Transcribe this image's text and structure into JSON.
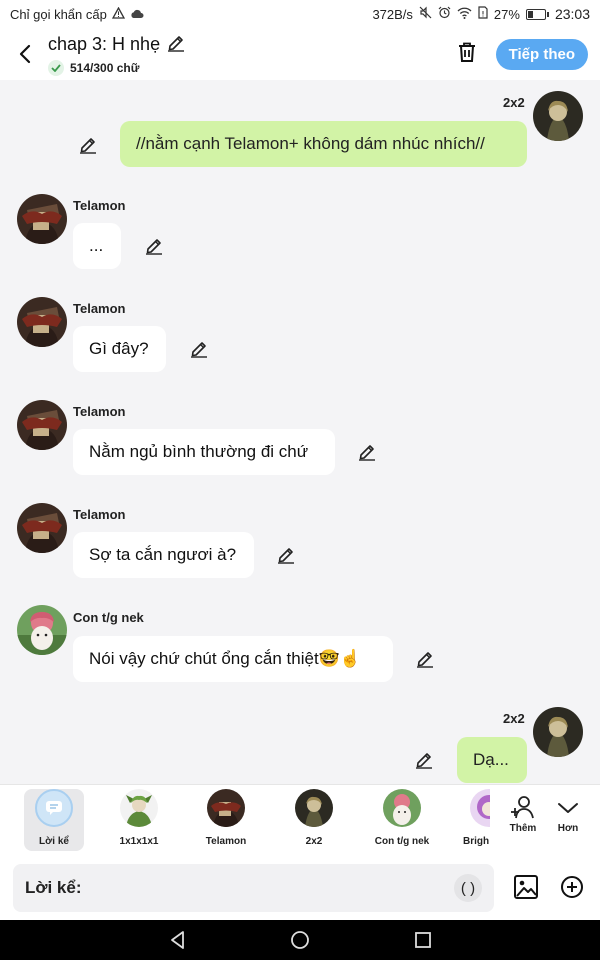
{
  "status_bar": {
    "carrier": "Chỉ gọi khẩn cấp",
    "speed": "372B/s",
    "battery": "27%",
    "time": "23:03"
  },
  "header": {
    "title": "chap 3: H nhẹ",
    "word_count": "514/300 chữ",
    "next_label": "Tiếp theo"
  },
  "messages": [
    {
      "side": "right",
      "name": "2x2",
      "text": "//nằm cạnh Telamon+ không dám nhúc nhích//",
      "avatar": "2x2"
    },
    {
      "side": "left",
      "name": "Telamon",
      "text": "...",
      "avatar": "telamon"
    },
    {
      "side": "left",
      "name": "Telamon",
      "text": "Gì đây?",
      "avatar": "telamon"
    },
    {
      "side": "left",
      "name": "Telamon",
      "text": "Nằm ngủ bình thường đi chứ",
      "avatar": "telamon"
    },
    {
      "side": "left",
      "name": "Telamon",
      "text": "Sợ ta cắn ngươi à?",
      "avatar": "telamon"
    },
    {
      "side": "left",
      "name": "Con t/g nek",
      "text": "Nói vậy chứ chút ổng cắn thiệt🤓☝️",
      "avatar": "cat"
    },
    {
      "side": "right",
      "name": "2x2",
      "text": "Dạ...",
      "avatar": "2x2"
    }
  ],
  "characters": [
    {
      "name": "Lời kể",
      "selected": true,
      "avatar": "narrator"
    },
    {
      "name": "1x1x1x1",
      "avatar": "green"
    },
    {
      "name": "Telamon",
      "avatar": "telamon"
    },
    {
      "name": "2x2",
      "avatar": "2x2"
    },
    {
      "name": "Con t/g nek",
      "avatar": "cat"
    },
    {
      "name": "Brigh",
      "avatar": "bright"
    }
  ],
  "tools": {
    "add_label": "Thêm",
    "more_label": "Hơn"
  },
  "input": {
    "label": "Lời kể:",
    "paren_label": "( )"
  },
  "colors": {
    "accent": "#5aa9f2",
    "right_bubble": "#d2f3a6",
    "left_bubble": "#ffffff",
    "background": "#f4f4f6"
  }
}
